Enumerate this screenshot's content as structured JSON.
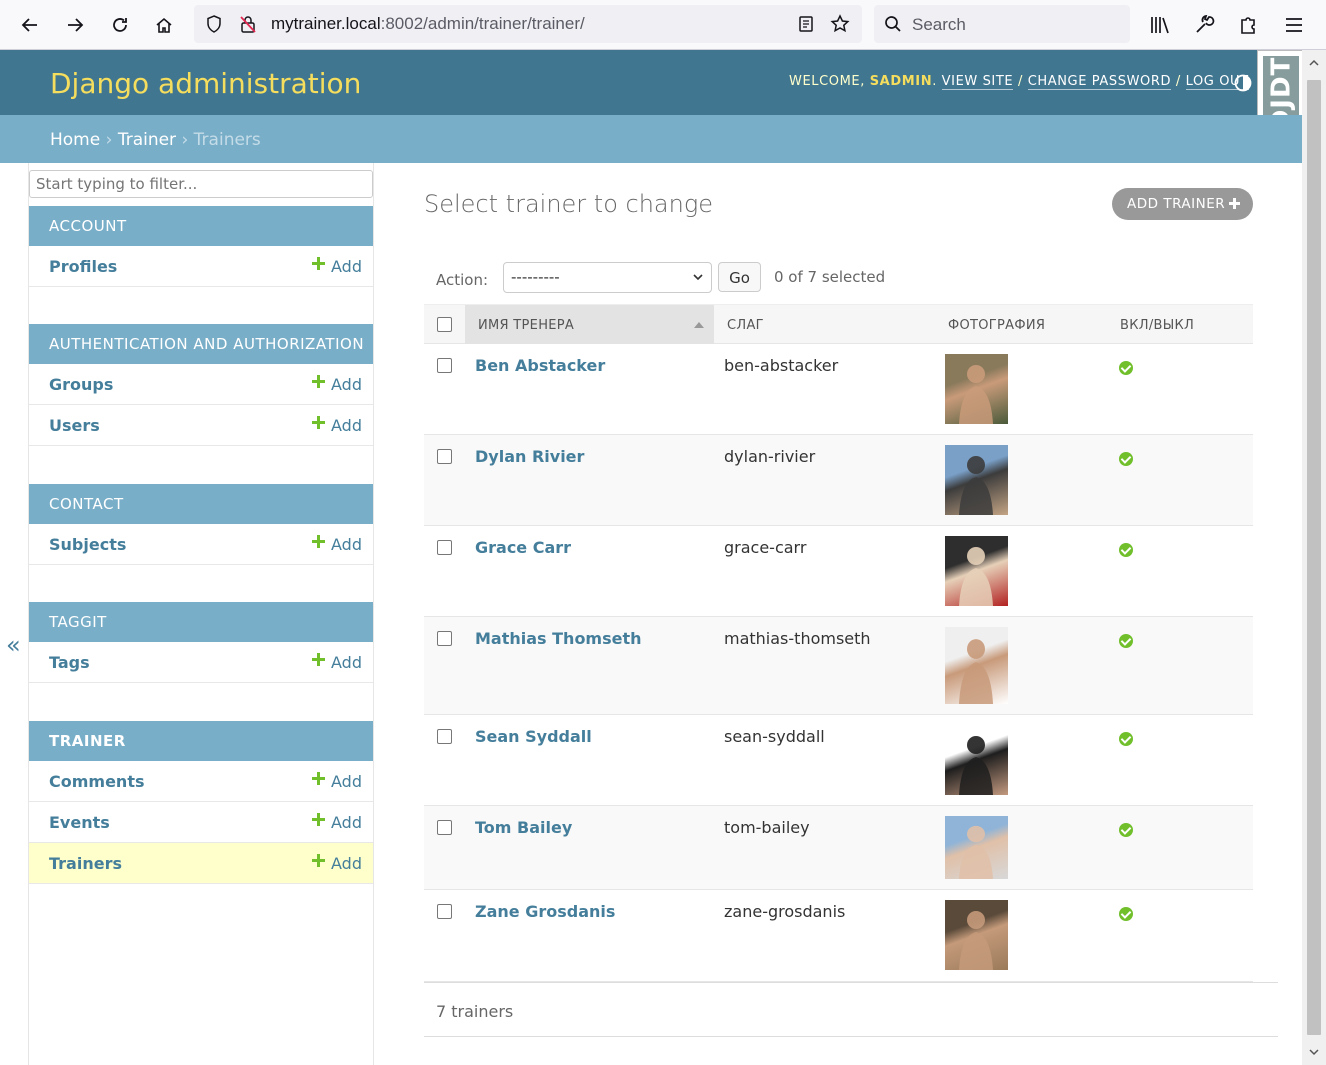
{
  "browser": {
    "url_host": "mytrainer.local",
    "url_rest": ":8002/admin/trainer/trainer/",
    "search_placeholder": "Search"
  },
  "header": {
    "branding": "Django administration",
    "welcome": "Welcome,",
    "username": "sadmin",
    "view_site": "View site",
    "change_password": "Change password",
    "log_out": "Log out",
    "debug_toolbar": "DJDT"
  },
  "breadcrumbs": {
    "home": "Home",
    "app": "Trainer",
    "current": "Trainers"
  },
  "sidebar": {
    "filter_placeholder": "Start typing to filter...",
    "add_label": "Add",
    "collapse_glyph": "«",
    "apps": [
      {
        "caption": "Account",
        "models": [
          "Profiles"
        ]
      },
      {
        "caption": "Authentication and Authorization",
        "models": [
          "Groups",
          "Users"
        ]
      },
      {
        "caption": "Contact",
        "models": [
          "Subjects"
        ]
      },
      {
        "caption": "Taggit",
        "models": [
          "Tags"
        ]
      },
      {
        "caption": "Trainer",
        "models": [
          "Comments",
          "Events",
          "Trainers"
        ],
        "current_model": "Trainers"
      }
    ]
  },
  "content": {
    "title": "Select trainer to change",
    "add_button": "Add trainer",
    "action_label": "Action:",
    "action_select_value": "---------",
    "go_button": "Go",
    "action_counter": "0 of 7 selected",
    "columns": [
      "Имя тренера",
      "Слаг",
      "Фотография",
      "Вкл/Выкл"
    ],
    "rows": [
      {
        "name": "Ben Abstacker",
        "slug": "ben-abstacker",
        "active": true,
        "photo_colors": [
          "#8a7a5c",
          "#c99b7a",
          "#4a5a3a"
        ]
      },
      {
        "name": "Dylan Rivier",
        "slug": "dylan-rivier",
        "active": true,
        "photo_colors": [
          "#7aa0c8",
          "#3c3c3c",
          "#c4a484"
        ]
      },
      {
        "name": "Grace Carr",
        "slug": "grace-carr",
        "active": true,
        "photo_colors": [
          "#2e2e2e",
          "#e6d0b8",
          "#b22222"
        ]
      },
      {
        "name": "Mathias Thomseth",
        "slug": "mathias-thomseth",
        "active": true,
        "photo_colors": [
          "#efefef",
          "#c89a7a",
          "#ffffff"
        ]
      },
      {
        "name": "Sean Syddall",
        "slug": "sean-syddall",
        "active": true,
        "photo_colors": [
          "#ffffff",
          "#1e1e1e",
          "#c49a80"
        ]
      },
      {
        "name": "Tom Bailey",
        "slug": "tom-bailey",
        "active": true,
        "photo_colors": [
          "#8fb4d8",
          "#e0c0a8",
          "#d8d8d8"
        ]
      },
      {
        "name": "Zane Grosdanis",
        "slug": "zane-grosdanis",
        "active": true,
        "photo_colors": [
          "#5a4a3a",
          "#c49a7a",
          "#9a7a5a"
        ]
      }
    ],
    "result_count": "7 trainers"
  }
}
